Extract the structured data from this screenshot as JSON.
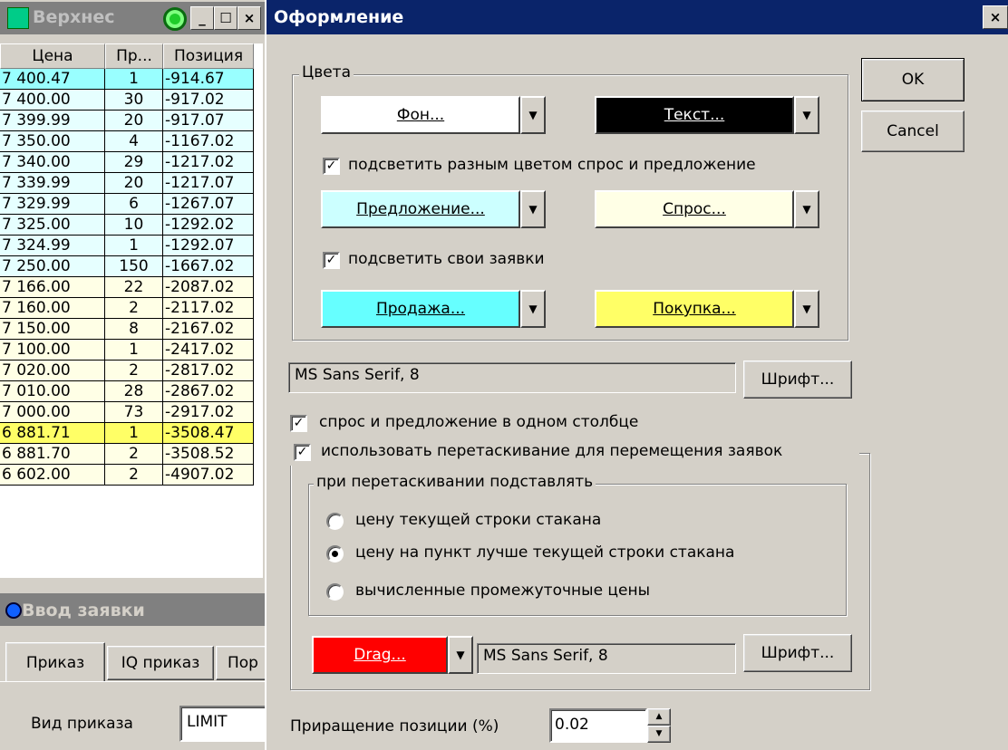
{
  "book_window": {
    "title": "Верхнес",
    "columns": [
      "Цена",
      "Пр...",
      "Позиция"
    ],
    "rows": [
      {
        "price": "7 400.47",
        "qty": "1",
        "pos": "-914.67",
        "color": "#99ffff"
      },
      {
        "price": "7 400.00",
        "qty": "30",
        "pos": "-917.02",
        "color": "#e6ffff"
      },
      {
        "price": "7 399.99",
        "qty": "20",
        "pos": "-917.07",
        "color": "#e6ffff"
      },
      {
        "price": "7 350.00",
        "qty": "4",
        "pos": "-1167.02",
        "color": "#e6ffff"
      },
      {
        "price": "7 340.00",
        "qty": "29",
        "pos": "-1217.02",
        "color": "#e6ffff"
      },
      {
        "price": "7 339.99",
        "qty": "20",
        "pos": "-1217.07",
        "color": "#e6ffff"
      },
      {
        "price": "7 329.99",
        "qty": "6",
        "pos": "-1267.07",
        "color": "#e6ffff"
      },
      {
        "price": "7 325.00",
        "qty": "10",
        "pos": "-1292.02",
        "color": "#e6ffff"
      },
      {
        "price": "7 324.99",
        "qty": "1",
        "pos": "-1292.07",
        "color": "#e6ffff"
      },
      {
        "price": "7 250.00",
        "qty": "150",
        "pos": "-1667.02",
        "color": "#e6ffff"
      },
      {
        "price": "7 166.00",
        "qty": "22",
        "pos": "-2087.02",
        "color": "#ffffe6"
      },
      {
        "price": "7 160.00",
        "qty": "2",
        "pos": "-2117.02",
        "color": "#ffffe6"
      },
      {
        "price": "7 150.00",
        "qty": "8",
        "pos": "-2167.02",
        "color": "#ffffe6"
      },
      {
        "price": "7 100.00",
        "qty": "1",
        "pos": "-2417.02",
        "color": "#ffffe6"
      },
      {
        "price": "7 020.00",
        "qty": "2",
        "pos": "-2817.02",
        "color": "#ffffe6"
      },
      {
        "price": "7 010.00",
        "qty": "28",
        "pos": "-2867.02",
        "color": "#ffffe6"
      },
      {
        "price": "7 000.00",
        "qty": "73",
        "pos": "-2917.02",
        "color": "#ffffe6"
      },
      {
        "price": "6 881.71",
        "qty": "1",
        "pos": "-3508.47",
        "color": "#ffff66"
      },
      {
        "price": "6 881.70",
        "qty": "2",
        "pos": "-3508.52",
        "color": "#ffffe6"
      },
      {
        "price": "6 602.00",
        "qty": "2",
        "pos": "-4907.02",
        "color": "#ffffe6"
      }
    ]
  },
  "order_window": {
    "title": "Ввод заявки",
    "tabs": [
      "Приказ",
      "IQ приказ",
      "Пор"
    ],
    "order_type_label": "Вид приказа",
    "order_type_value": "LIMIT"
  },
  "dialog": {
    "title": "Оформление",
    "close": "×",
    "ok": "OK",
    "cancel": "Cancel",
    "colors_group": "Цвета",
    "bg_button": "Фон...",
    "text_button": "Текст...",
    "highlight_bidask": "подсветить разным цветом спрос и предложение",
    "offer_button": "Предложение...",
    "demand_button": "Спрос...",
    "highlight_own": "подсветить свои заявки",
    "sell_button": "Продажа...",
    "buy_button": "Покупка...",
    "font_value": "MS Sans Serif, 8",
    "font_button": "Шрифт...",
    "one_column": "спрос и предложение в одном столбце",
    "use_drag": "использовать перетаскивание для перемещения заявок",
    "drag_group": "при перетаскивании подставлять",
    "radio1": "цену текущей строки стакана",
    "radio2": "цену на пункт лучше текущей строки стакана",
    "radio3": "вычисленные промежуточные цены",
    "drag_button": "Drag...",
    "drag_font_value": "MS Sans Serif, 8",
    "drag_font_button": "Шрифт...",
    "increment_label": "Приращение позиции (%)",
    "increment_value": "0.02"
  },
  "colors": {
    "bg": "#ffffff",
    "text": "#000000",
    "offer": "#ccffff",
    "demand": "#ffffe6",
    "sell": "#66ffff",
    "buy": "#ffff66",
    "drag": "#ff0000"
  }
}
